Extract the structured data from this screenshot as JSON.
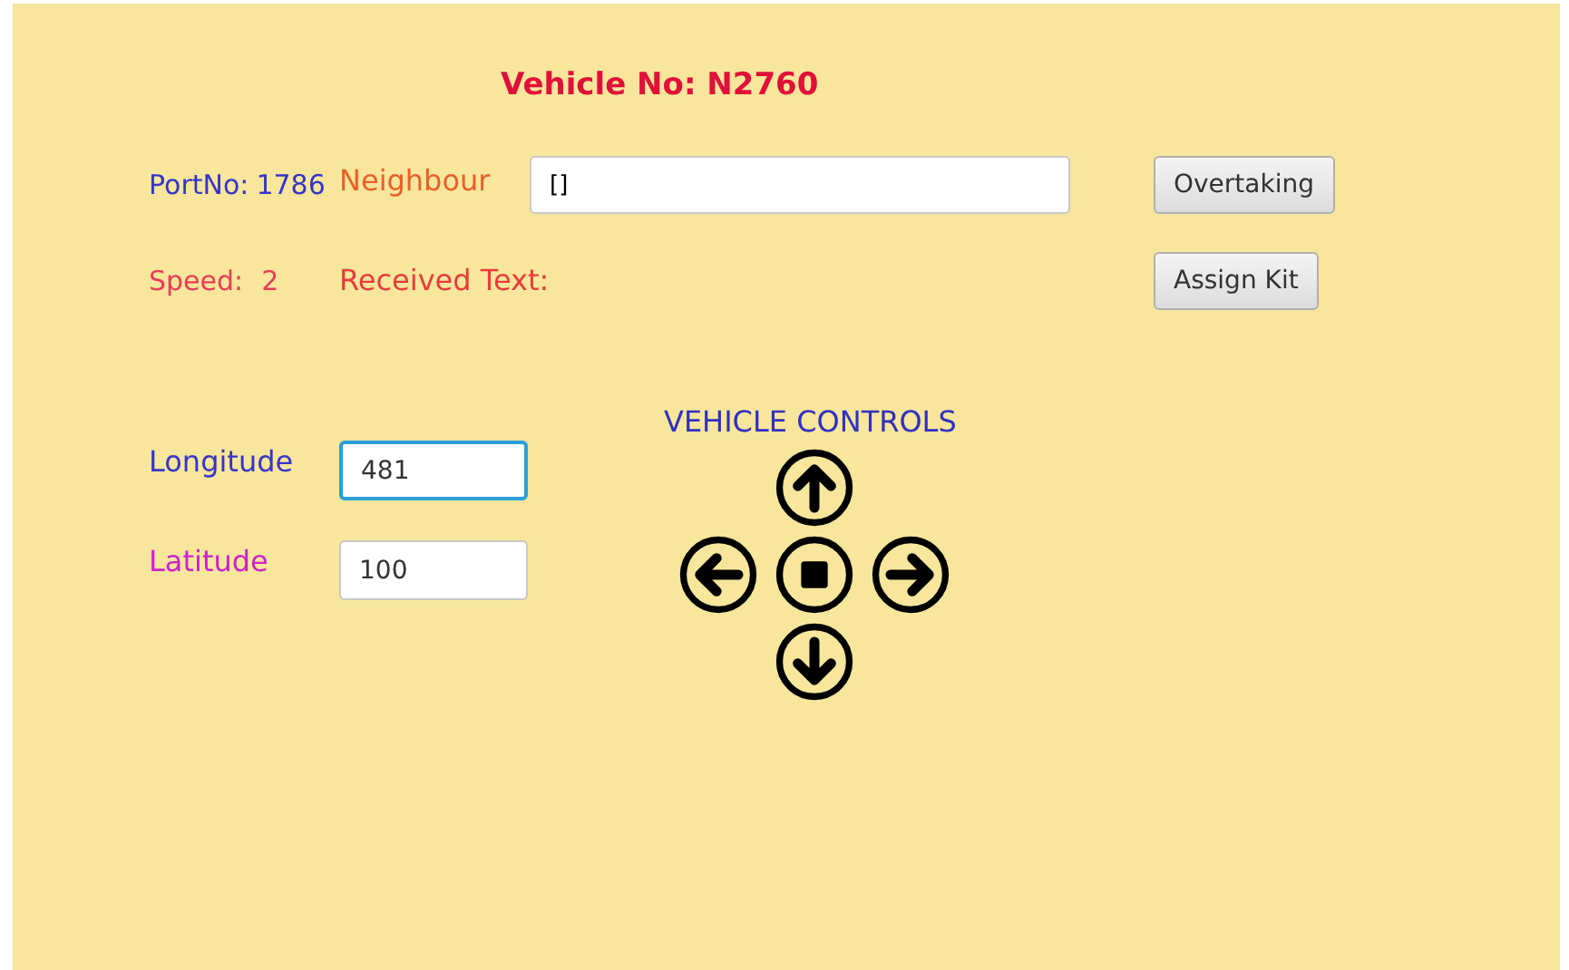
{
  "title": "Vehicle No: N2760",
  "port": {
    "label": "PortNo:",
    "value": "1786"
  },
  "speed": {
    "label": "Speed:",
    "value": "2"
  },
  "neighbour": {
    "label": "Neighbour",
    "value": "[]"
  },
  "received_text": {
    "label": "Received Text:"
  },
  "buttons": [
    "Overtaking",
    "Assign Kit"
  ],
  "coordinates": [
    {
      "label": "Longitude",
      "value": "481",
      "focused": true,
      "color": "#3535c8"
    },
    {
      "label": "Latitude",
      "value": "100",
      "focused": false,
      "color": "#cc22cc"
    }
  ],
  "controls": {
    "title": "VEHICLE CONTROLS",
    "buttons": [
      {
        "kind": "up"
      },
      {
        "kind": "left"
      },
      {
        "kind": "stop"
      },
      {
        "kind": "right"
      },
      {
        "kind": "down"
      }
    ]
  }
}
